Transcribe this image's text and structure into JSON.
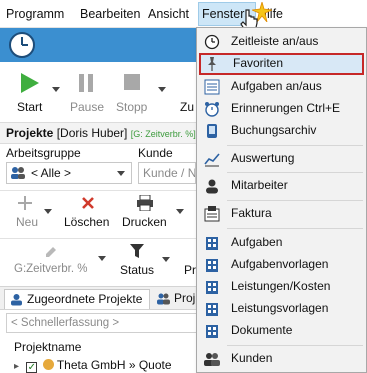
{
  "menubar": {
    "items": [
      "Programm",
      "Bearbeiten",
      "Ansicht",
      "Fenster",
      "Hilfe"
    ]
  },
  "toolbar1": {
    "start": "Start",
    "pause": "Pause",
    "stopp": "Stopp",
    "zu_partial": "Zu"
  },
  "project": {
    "title": "Projekte",
    "user": "[Doris Huber]",
    "tag": "[G: Zeitverbr. %]"
  },
  "filters": {
    "arbeitsgruppe_label": "Arbeitsgruppe",
    "arbeitsgruppe_value": "< Alle >",
    "kunde_label": "Kunde",
    "kunde_placeholder": "Kunde / N"
  },
  "toolbar2": {
    "neu": "Neu",
    "loeschen": "Löschen",
    "drucken": "Drucken"
  },
  "toolbar3": {
    "zeitverbr": "G:Zeitverbr. %",
    "status": "Status",
    "pr_partial": "Pr"
  },
  "tabs": {
    "zugeordnete": "Zugeordnete Projekte",
    "proj_partial": "Proj"
  },
  "list": {
    "quick_placeholder": "< Schnellerfassung >",
    "column": "Projektname",
    "row1": "Theta GmbH » Quote"
  },
  "dropdown": {
    "items": [
      {
        "label": "Zeitleiste an/aus",
        "icon": "clock-icon"
      },
      {
        "label": "Favoriten",
        "icon": "pin-icon"
      },
      {
        "label": "Aufgaben an/aus",
        "icon": "checklist-icon"
      },
      {
        "label": "Erinnerungen Ctrl+E",
        "icon": "alarm-clock-icon"
      },
      {
        "label": "Buchungsarchiv",
        "icon": "phone-archive-icon"
      },
      {
        "label": "Auswertung",
        "icon": "chart-icon"
      },
      {
        "label": "Mitarbeiter",
        "icon": "user-icon"
      },
      {
        "label": "Faktura",
        "icon": "invoice-icon"
      },
      {
        "label": "Aufgaben",
        "icon": "building-icon"
      },
      {
        "label": "Aufgabenvorlagen",
        "icon": "building-icon"
      },
      {
        "label": "Leistungen/Kosten",
        "icon": "building-icon"
      },
      {
        "label": "Leistungsvorlagen",
        "icon": "building-icon"
      },
      {
        "label": "Dokumente",
        "icon": "building-icon"
      },
      {
        "label": "Kunden",
        "icon": "users-icon"
      }
    ]
  },
  "colors": {
    "accent_blue": "#3b8fd0",
    "highlight_border": "#c62828",
    "start_green": "#3fae3f",
    "delete_red": "#d03a2c"
  }
}
